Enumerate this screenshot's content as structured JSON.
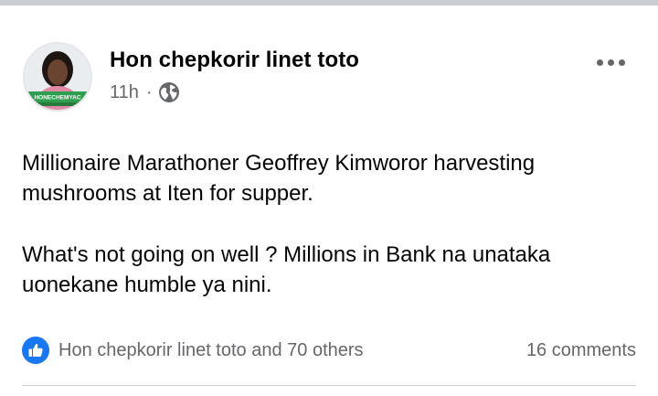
{
  "post": {
    "author": "Hon chepkorir linet toto",
    "time": "11h",
    "separator": "·",
    "privacy_icon": "globe-icon",
    "more_icon": "more-dots-icon",
    "avatar_banner_text": "HONECHEMYAC",
    "body_paragraphs": [
      "Millionaire Marathoner Geoffrey Kimworor harvesting mushrooms at Iten for supper.",
      "What's not going on well ? Millions in Bank na unataka uonekane humble ya nini."
    ]
  },
  "engagement": {
    "reaction_icon": "like-icon",
    "reactions_text": "Hon chepkorir linet toto and 70 others",
    "comments_text": "16 comments"
  },
  "colors": {
    "accent": "#1877f2",
    "secondary_text": "#65676b",
    "primary_text": "#050505",
    "avatar_banner": "#2e9e4f"
  }
}
